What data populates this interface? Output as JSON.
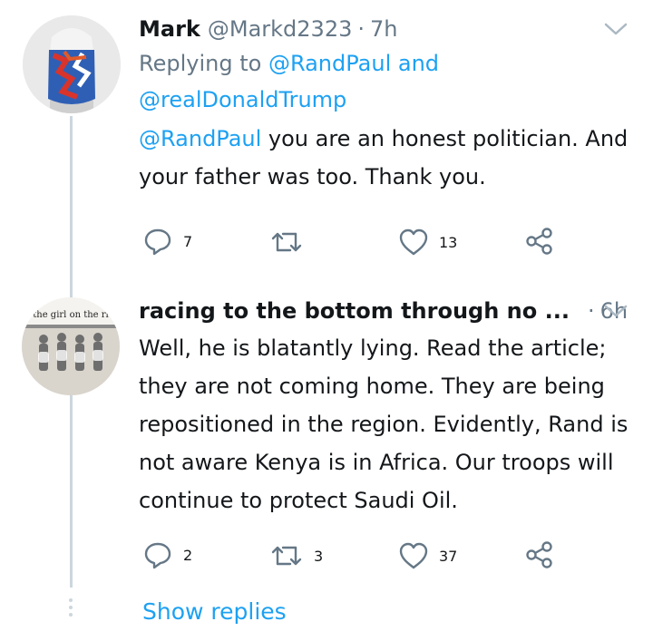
{
  "tweets": [
    {
      "name": "Mark",
      "handle": "@Markd2323",
      "separator": "·",
      "time": "7h",
      "reply_prefix": "Replying to",
      "reply_user1": "@RandPaul",
      "reply_and": "and",
      "reply_user2": "@realDonaldTrump",
      "body_mention": "@RandPaul",
      "body_text": " you are an honest politician. And your father was too.  Thank you.",
      "replies": "7",
      "retweets": "",
      "likes": "13"
    },
    {
      "name": "racing to the bottom through no ...",
      "separator": "·",
      "time": "6h",
      "avatar_text": "the girl on the ri",
      "body_text": "Well, he is blatantly lying. Read the article; they are not coming home. They are being repositioned in the region. Evidently, Rand is not aware Kenya is in Africa. Our troops will continue to protect Saudi Oil.",
      "replies": "2",
      "retweets": "3",
      "likes": "37"
    }
  ],
  "show_replies": "Show replies",
  "colors": {
    "accent": "#1da1f2",
    "muted": "#657786",
    "line": "#ccd6dd"
  },
  "icons": [
    "reply-icon",
    "retweet-icon",
    "like-icon",
    "share-icon",
    "chevron-down-icon"
  ]
}
